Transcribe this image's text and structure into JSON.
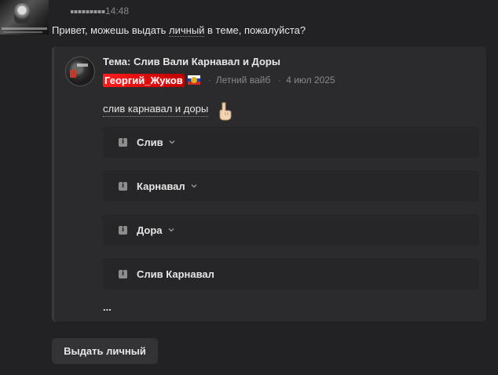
{
  "message": {
    "time": "14:48",
    "text_before": "Привет, можешь выдать ",
    "text_link": "личный",
    "text_after": " в теме, пожалуйста?"
  },
  "quote": {
    "title": "Тема: Слив Вали Карнавал и Доры",
    "author": "Георгий_Жуков",
    "author_color": "#ff1e1e",
    "separator": "·",
    "forum": "Летний вайб",
    "date": "4 июл 2025",
    "body": "слив карнавал и доры",
    "body_icon": "pointing-down-hand-icon",
    "spoilers": [
      {
        "label": "Слив",
        "has_chevron": true
      },
      {
        "label": "Карнавал",
        "has_chevron": true
      },
      {
        "label": "Дора",
        "has_chevron": true
      },
      {
        "label": "Слив Карнавал",
        "has_chevron": false
      }
    ],
    "more": "..."
  },
  "action_button": {
    "label": "Выдать личный"
  }
}
